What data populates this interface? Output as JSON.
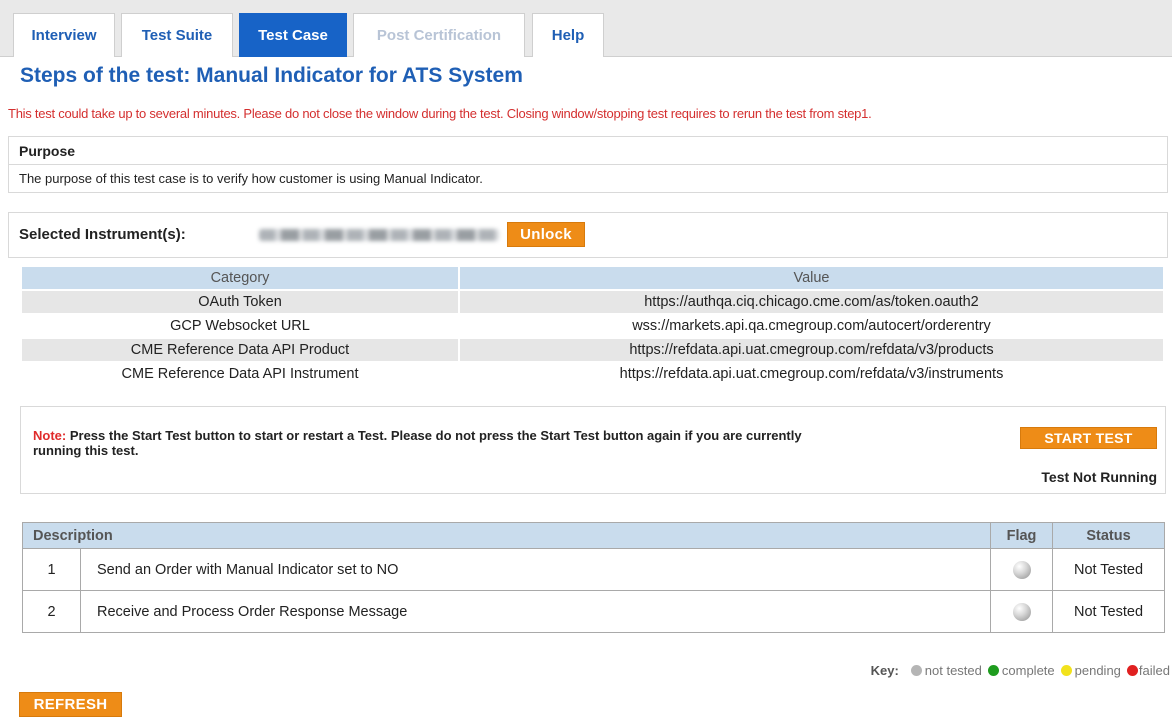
{
  "tabs": [
    {
      "label": "Interview",
      "state": "normal"
    },
    {
      "label": "Test Suite",
      "state": "normal"
    },
    {
      "label": "Test Case",
      "state": "active"
    },
    {
      "label": "Post Certification",
      "state": "disabled"
    },
    {
      "label": "Help",
      "state": "normal"
    }
  ],
  "page": {
    "title": "Steps of the test: Manual Indicator for ATS System",
    "warning": "This test could take up to several minutes. Please do not close the window during the test. Closing window/stopping test requires to rerun the test from step1."
  },
  "purpose": {
    "heading": "Purpose",
    "text": "The purpose of this test case is to verify how customer is using Manual Indicator."
  },
  "instrument": {
    "label": "Selected Instrument(s):",
    "unlock_label": "Unlock"
  },
  "config": {
    "headers": [
      "Category",
      "Value"
    ],
    "rows": [
      {
        "category": "OAuth Token",
        "value": "https://authqa.ciq.chicago.cme.com/as/token.oauth2"
      },
      {
        "category": "GCP Websocket URL",
        "value": "wss://markets.api.qa.cmegroup.com/autocert/orderentry"
      },
      {
        "category": "CME Reference Data API Product",
        "value": "https://refdata.api.uat.cmegroup.com/refdata/v3/products"
      },
      {
        "category": "CME Reference Data API Instrument",
        "value": "https://refdata.api.uat.cmegroup.com/refdata/v3/instruments"
      }
    ]
  },
  "note": {
    "label": "Note:",
    "text": "Press the Start Test button to start or restart a Test. Please do not press the Start Test button again if you are currently running this test.",
    "start_button": "START TEST",
    "test_status": "Test Not Running"
  },
  "steps": {
    "headers": {
      "description": "Description",
      "flag": "Flag",
      "status": "Status"
    },
    "rows": [
      {
        "num": "1",
        "description": "Send an Order with Manual Indicator set to NO",
        "status": "Not Tested"
      },
      {
        "num": "2",
        "description": "Receive and Process Order Response Message",
        "status": "Not Tested"
      }
    ]
  },
  "key": {
    "label": "Key:",
    "items": [
      {
        "label": "not tested",
        "color": "#b5b5b5"
      },
      {
        "label": "complete",
        "color": "#1e9c1e"
      },
      {
        "label": "pending",
        "color": "#f2e21c"
      },
      {
        "label": "failed",
        "color": "#e02020"
      }
    ]
  },
  "refresh_label": "REFRESH"
}
